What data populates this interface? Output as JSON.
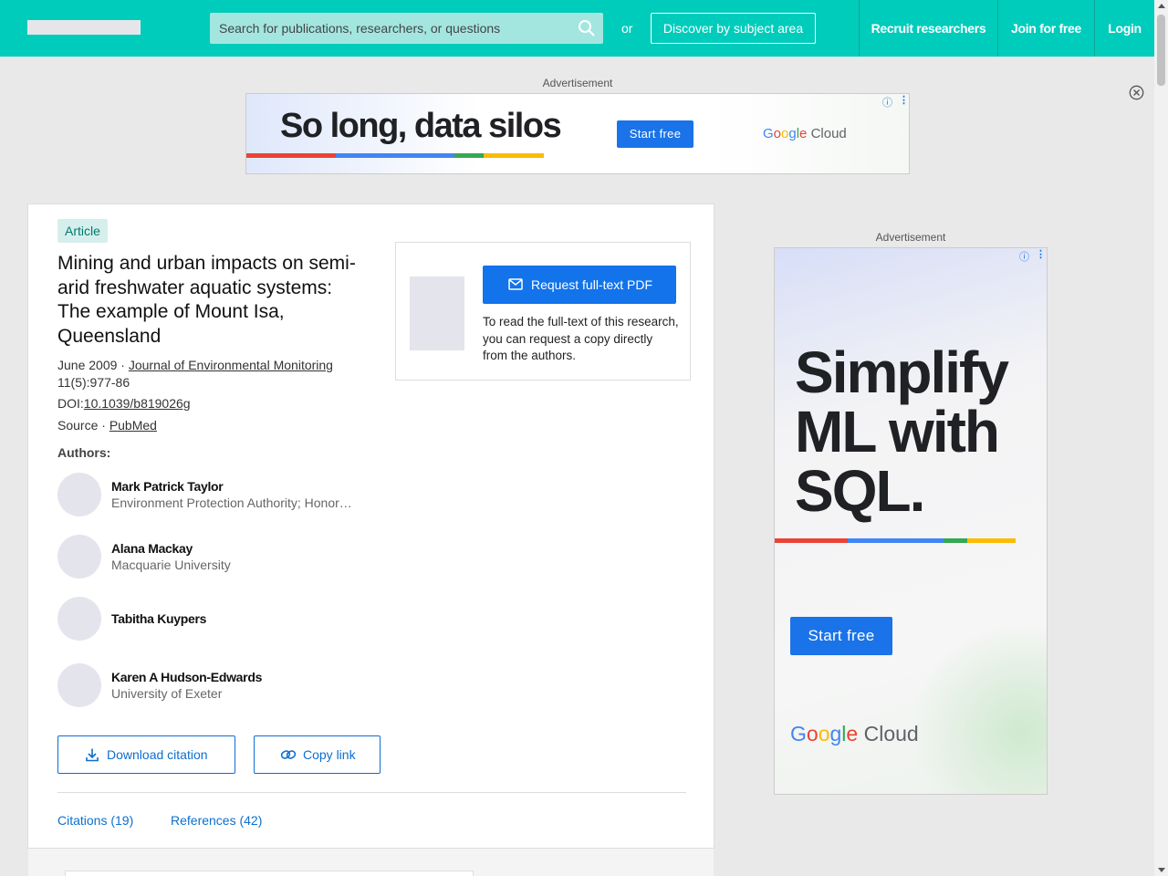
{
  "header": {
    "search_placeholder": "Search for publications, researchers, or questions",
    "or_text": "or",
    "discover_label": "Discover by subject area",
    "recruit_label": "Recruit researchers",
    "join_label": "Join for free",
    "login_label": "Login"
  },
  "top_ad": {
    "label": "Advertisement",
    "headline": "So long, data silos",
    "cta": "Start free",
    "brand_g": [
      "G",
      "o",
      "o",
      "g",
      "l",
      "e"
    ],
    "brand_cloud": "Cloud"
  },
  "article": {
    "type_badge": "Article",
    "title": "Mining and urban impacts on semi-arid freshwater aquatic systems: The example of Mount Isa, Queensland",
    "date": "June 2009 · ",
    "journal": "Journal of Environmental Monitoring",
    "volume": "11(5):977-86",
    "doi_label": "DOI:",
    "doi": "10.1039/b819026g",
    "source_label": "Source · ",
    "source": "PubMed",
    "authors_label": "Authors:",
    "authors": [
      {
        "name": "Mark Patrick Taylor",
        "affiliation": "Environment Protection Authority; Honorary..."
      },
      {
        "name": "Alana Mackay",
        "affiliation": "Macquarie University"
      },
      {
        "name": "Tabitha Kuypers",
        "affiliation": ""
      },
      {
        "name": "Karen A Hudson-Edwards",
        "affiliation": "University of Exeter"
      }
    ],
    "download_citation": "Download citation",
    "copy_link": "Copy link",
    "citations_tab": "Citations (19)",
    "references_tab": "References (42)"
  },
  "request": {
    "button": "Request full-text PDF",
    "text": "To read the full-text of this research, you can request a copy directly from the authors."
  },
  "side_ad": {
    "label": "Advertisement",
    "headline": "Simplify ML with SQL.",
    "cta": "Start free",
    "brand_cloud": "Cloud"
  },
  "colors": {
    "header_bg": "#00ccbb",
    "link_blue": "#0d6fcf",
    "button_blue": "#1273eb",
    "google_red": "#ea4335",
    "google_blue": "#4285f4",
    "google_green": "#34a853",
    "google_yellow": "#fbbc05"
  }
}
